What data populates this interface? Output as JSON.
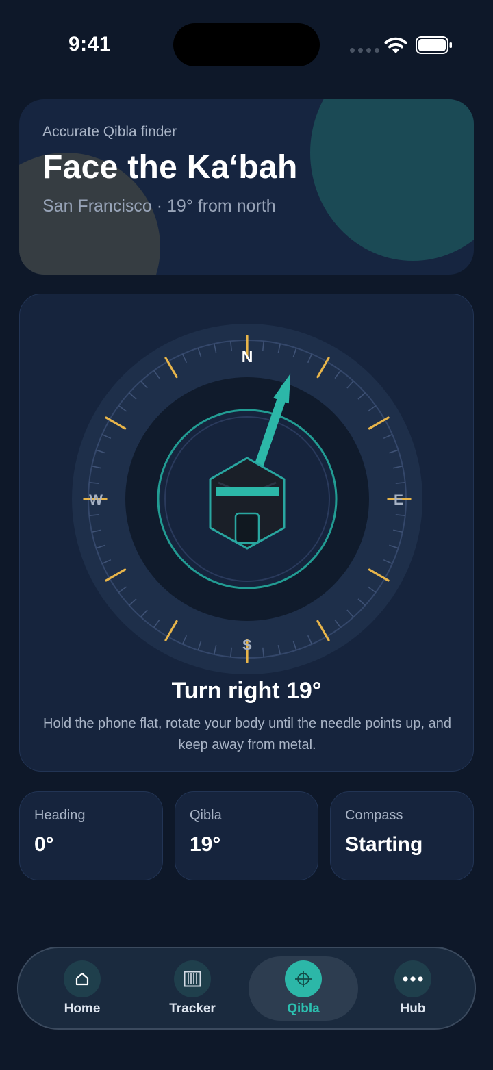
{
  "status_bar": {
    "time": "9:41"
  },
  "header": {
    "eyebrow": "Accurate Qibla finder",
    "title": "Face the Ka‘bah",
    "subtitle": "San Francisco · 19° from north"
  },
  "compass": {
    "cardinals": {
      "n": "N",
      "e": "E",
      "s": "S",
      "w": "W"
    },
    "needle_bearing_deg": 19,
    "turn_title": "Turn right 19°",
    "instruction": "Hold the phone flat, rotate your body until the needle points up, and keep away from metal."
  },
  "stats": [
    {
      "label": "Heading",
      "value": "0°"
    },
    {
      "label": "Qibla",
      "value": "19°"
    },
    {
      "label": "Compass",
      "value": "Starting"
    }
  ],
  "tabbar": {
    "items": [
      {
        "label": "Home",
        "icon": "home-icon"
      },
      {
        "label": "Tracker",
        "icon": "tracker-icon"
      },
      {
        "label": "Qibla",
        "icon": "crosshair-icon",
        "active": true
      },
      {
        "label": "Hub",
        "icon": "more-icon"
      }
    ]
  },
  "colors": {
    "background": "#0e1829",
    "card": "#16243d",
    "accent_teal": "#2cb7a8",
    "tick_amber": "#e8b54a"
  }
}
